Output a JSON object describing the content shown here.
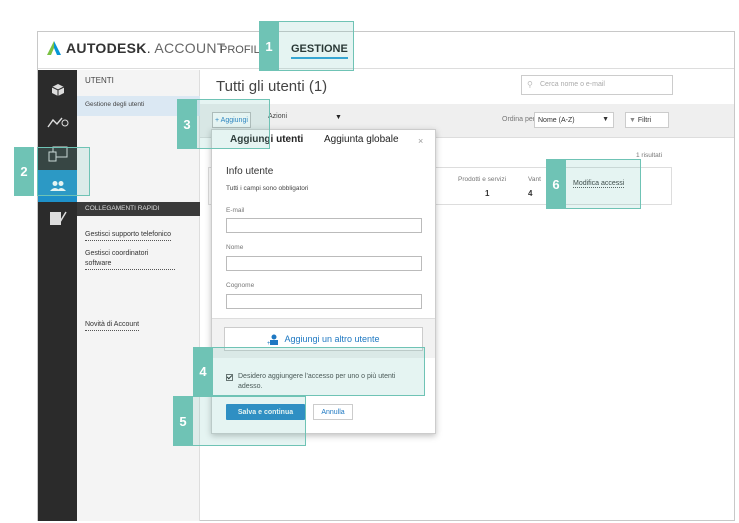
{
  "header": {
    "logo_brand": "AUTODESK",
    "logo_suffix": "ACCOUNT",
    "nav_profile": "PROFILO",
    "nav_gestione": "GESTIONE"
  },
  "iconbar": {
    "icons": [
      "box-icon",
      "analytics-icon",
      "devices-icon",
      "users-icon",
      "reports-icon"
    ],
    "active_color": "#1e90c8"
  },
  "sidebar": {
    "title": "UTENTI",
    "selected_item": "Gestione degli utenti",
    "quick_links_header": "COLLEGAMENTI RAPIDI",
    "links": [
      "Gestisci supporto telefonico",
      "Gestisci coordinatori software"
    ],
    "news_link": "Novità di Account"
  },
  "main": {
    "title": "Tutti gli utenti (1)",
    "search_placeholder": "Cerca nome o e-mail",
    "add_button": "+ Aggiungi",
    "actions_label": "Azioni",
    "sort_label": "Ordina per:",
    "sort_value": "Nome (A-Z)",
    "filter_label": "Filtri",
    "results": "1 risultati",
    "row": {
      "products_label": "Prodotti e servizi",
      "products_value": "1",
      "benefits_label": "Vant",
      "benefits_value": "4",
      "edit_access": "Modifica accessi"
    }
  },
  "modal": {
    "tab_add_users": "Aggiungi utenti",
    "tab_bulk_add": "Aggiunta globale",
    "close": "×",
    "section_title": "Info utente",
    "required_note": "Tutti i campi sono obbligatori",
    "email_label": "E-mail",
    "name_label": "Nome",
    "surname_label": "Cognome",
    "add_another": "Aggiungi un altro utente",
    "checkbox_text": "Desidero aggiungere l'accesso per uno o più utenti adesso.",
    "checkbox_checked": true,
    "save_button": "Salva e continua",
    "cancel_button": "Annulla"
  },
  "callouts": [
    "1",
    "2",
    "3",
    "4",
    "5",
    "6"
  ],
  "colors": {
    "accent": "#2184c6",
    "callout": "#6fc3b5",
    "logo_primary": "#0696d7"
  }
}
